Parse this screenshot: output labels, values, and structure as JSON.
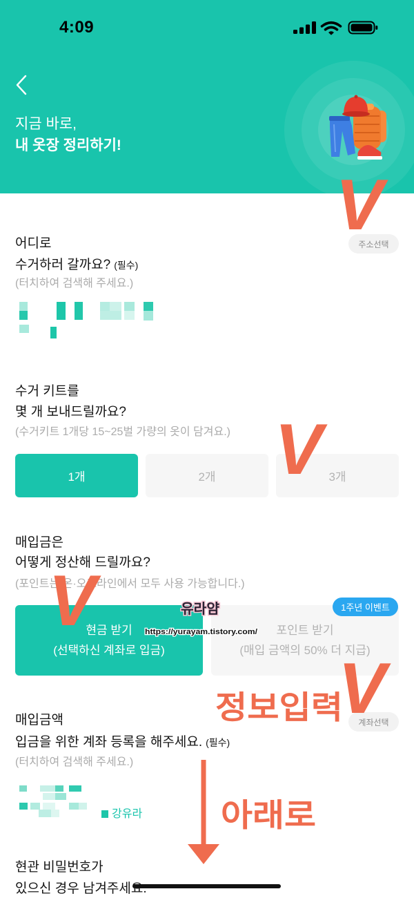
{
  "status_bar": {
    "time": "4:09",
    "icons": [
      "signal-icon",
      "wifi-icon",
      "battery-icon"
    ]
  },
  "header": {
    "back_icon": "chevron-left-icon",
    "title_line1": "지금 바로,",
    "title_line2": "내 옷장 정리하기!",
    "illustration": "clothes-illustration"
  },
  "pickup": {
    "question_line1": "어디로",
    "question_line2": "수거하러 갈까요?",
    "required": "(필수)",
    "hint": "(터치하여 검색해 주세요.)",
    "select_button": "주소선택"
  },
  "kit": {
    "question_line1": "수거 키트를",
    "question_line2": "몇 개 보내드릴까요?",
    "hint": "(수거키트 1개당 15~25벌 가량의 옷이 담겨요.)",
    "options": [
      {
        "label": "1개",
        "selected": true
      },
      {
        "label": "2개",
        "selected": false
      },
      {
        "label": "3개",
        "selected": false
      }
    ]
  },
  "payment": {
    "question_line1": "매입금은",
    "question_line2": "어떻게 정산해 드릴까요?",
    "hint": "(포인트는 온·오프라인에서 모두 사용 가능합니다.)",
    "badge": "1주년 이벤트",
    "options": [
      {
        "title": "현금 받기",
        "desc": "(선택하신 계좌로 입금)",
        "selected": true
      },
      {
        "title": "포인트 받기",
        "desc": "(매입 금액의 50% 더 지급)",
        "selected": false
      }
    ]
  },
  "account": {
    "question_line1": "매입금액",
    "question_line2": "입금을 위한 계좌 등록을 해주세요.",
    "required": "(필수)",
    "hint": "(터치하여 검색해 주세요.)",
    "holder_name": "강유라",
    "select_button": "계좌선택"
  },
  "door": {
    "question_line1": "현관 비밀번호가",
    "question_line2": "있으신 경우 남겨주세요."
  },
  "annotations": {
    "marks": [
      "V",
      "V",
      "V",
      "V"
    ],
    "info_label": "정보입력",
    "down_label": "아래로"
  },
  "watermark": {
    "name": "유라얌",
    "url": "https://yurayam.tistory.com/"
  },
  "colors": {
    "accent": "#19C4AC",
    "badge": "#2AA7F0",
    "annotation": "#EF6C4E",
    "inactive_option": "#F6F6F6"
  }
}
